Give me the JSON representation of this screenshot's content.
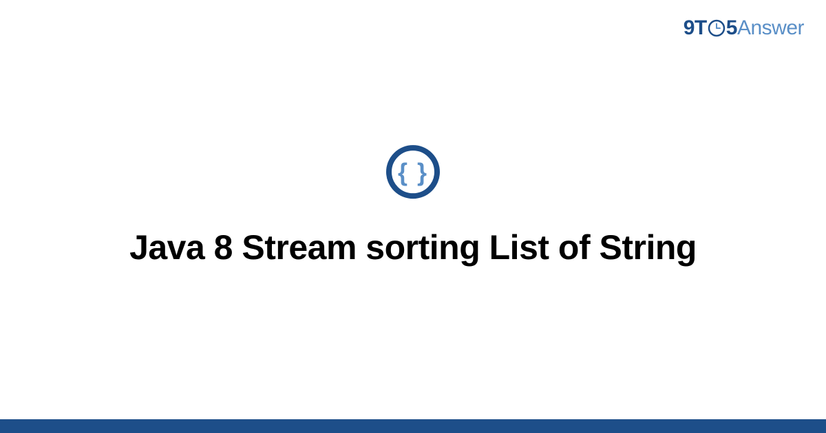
{
  "header": {
    "logo_part1": "9T",
    "logo_part2": "5",
    "logo_part3": "Answer"
  },
  "main": {
    "title": "Java 8 Stream sorting List of String"
  },
  "colors": {
    "brand_dark": "#1d4e89",
    "brand_light": "#5a8fc7",
    "icon_ring": "#1d4e89",
    "icon_brace": "#5a8fc7"
  }
}
